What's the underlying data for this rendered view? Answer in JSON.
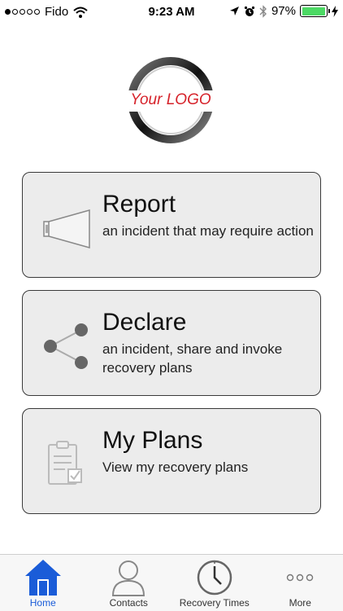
{
  "status_bar": {
    "carrier": "Fido",
    "time": "9:23 AM",
    "battery": "97%",
    "battery_level": 0.97
  },
  "logo": {
    "text": "Your LOGO"
  },
  "cards": [
    {
      "title": "Report",
      "description": "an incident that may require action",
      "icon": "horn-icon"
    },
    {
      "title": "Declare",
      "description": "an incident, share and invoke recovery plans",
      "icon": "share-icon"
    },
    {
      "title": "My Plans",
      "description": "View my recovery plans",
      "icon": "clipboard-check-icon"
    }
  ],
  "tabs": [
    {
      "label": "Home",
      "icon": "home-icon",
      "active": true
    },
    {
      "label": "Contacts",
      "icon": "person-icon",
      "active": false
    },
    {
      "label": "Recovery Times",
      "icon": "clock-icon",
      "active": false
    },
    {
      "label": "More",
      "icon": "more-icon",
      "active": false
    }
  ],
  "colors": {
    "accent": "#1a5cd8",
    "logo_text": "#d6232b",
    "battery": "#4cd964",
    "card_bg": "#ececec"
  }
}
